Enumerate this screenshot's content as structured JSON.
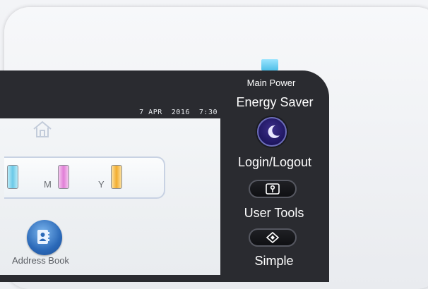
{
  "screen": {
    "datetime": "7 APR  2016  7:30"
  },
  "toner": {
    "labels": [
      "M",
      "Y"
    ],
    "colors": {
      "cyan": "#7fd3ee",
      "magenta": "#e58cdb",
      "yellow": "#f5b83d"
    }
  },
  "apps": {
    "address_book_label": "Address Book",
    "address_book_icon": "address-book-icon",
    "home_icon": "home-icon"
  },
  "side_panel": {
    "main_power_label": "Main Power",
    "energy_saver_label": "Energy Saver",
    "login_logout_label": "Login/Logout",
    "user_tools_label": "User Tools",
    "simple_label": "Simple",
    "indicator_color": "#5cc8ef",
    "icons": [
      "moon-icon",
      "key-icon",
      "diamond-icon"
    ]
  }
}
